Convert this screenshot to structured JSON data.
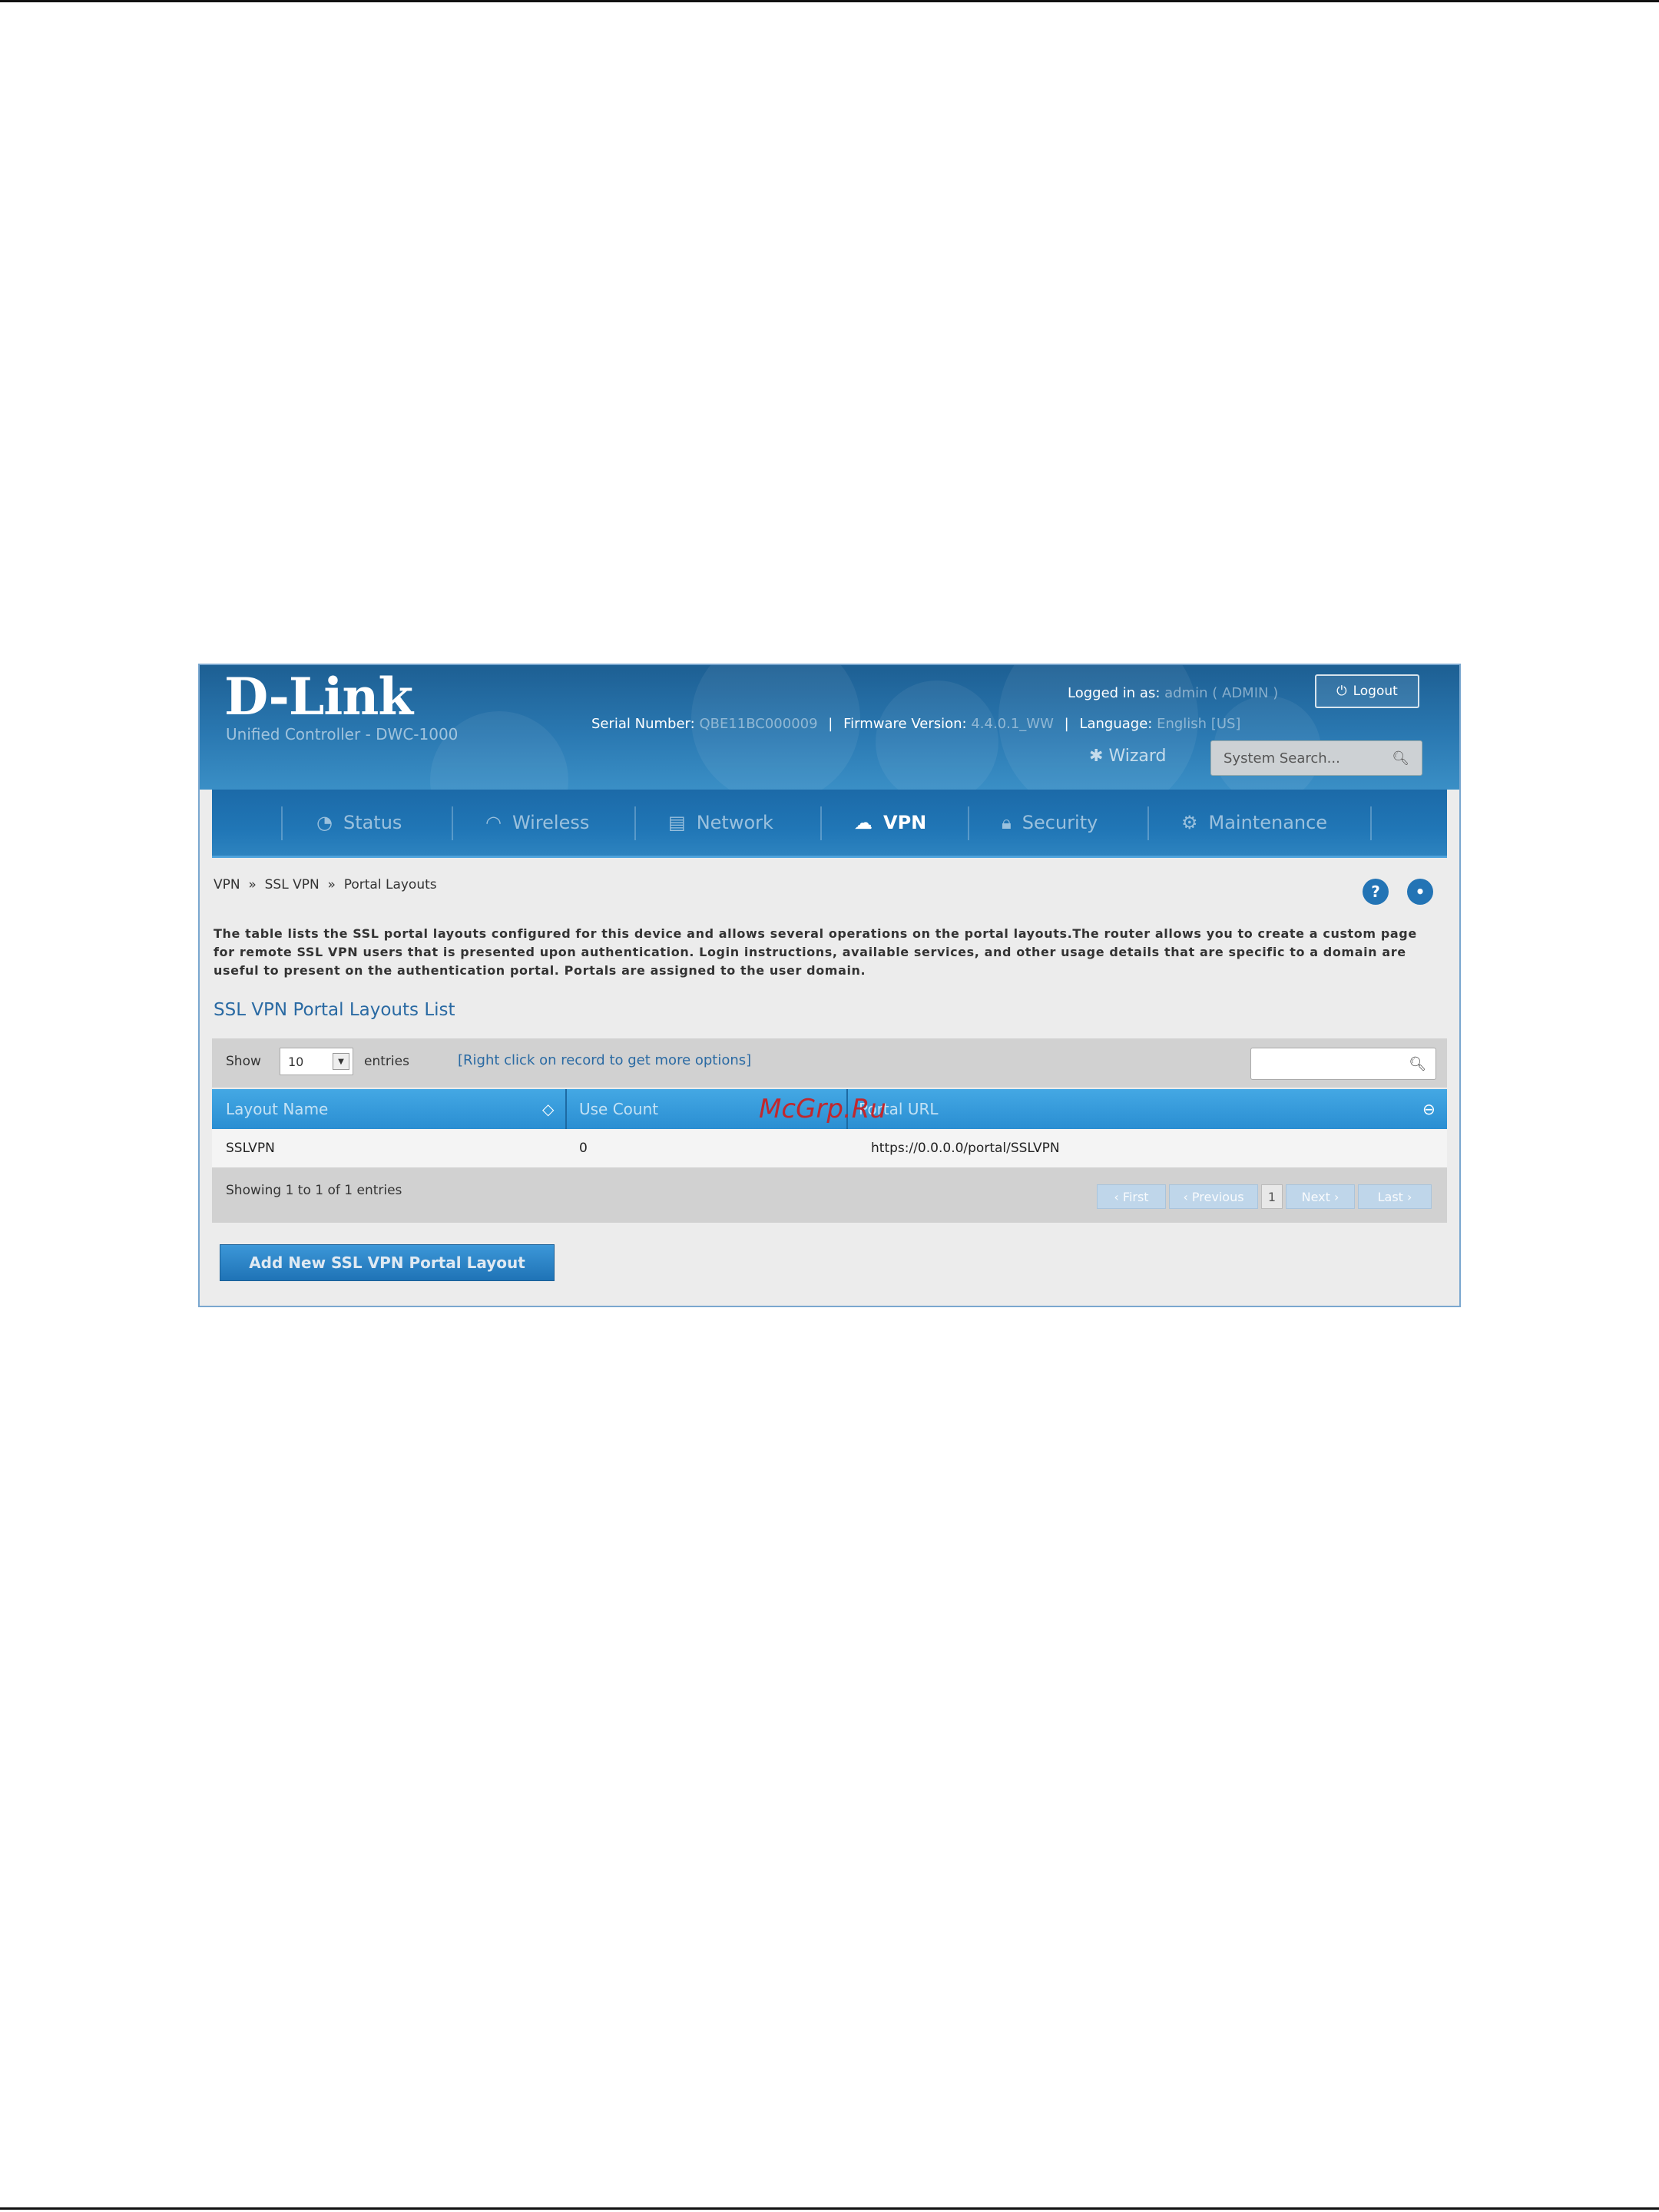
{
  "header": {
    "brand": "D-Link",
    "product": "Unified Controller - DWC-1000",
    "logged_in_label": "Logged in as:",
    "logged_in_user": "admin ( ADMIN )",
    "logout_label": "Logout",
    "serial_label": "Serial Number:",
    "serial_value": "QBE11BC000009",
    "firmware_label": "Firmware Version:",
    "firmware_value": "4.4.0.1_WW",
    "language_label": "Language:",
    "language_value": "English [US]",
    "wizard_label": "Wizard",
    "search_placeholder": "System Search..."
  },
  "nav": {
    "items": [
      {
        "label": "Status",
        "icon": "gauge-icon"
      },
      {
        "label": "Wireless",
        "icon": "wifi-icon"
      },
      {
        "label": "Network",
        "icon": "network-icon"
      },
      {
        "label": "VPN",
        "icon": "cloud-icon"
      },
      {
        "label": "Security",
        "icon": "lock-icon"
      },
      {
        "label": "Maintenance",
        "icon": "gears-icon"
      }
    ],
    "active": "VPN"
  },
  "breadcrumb": [
    "VPN",
    "SSL VPN",
    "Portal Layouts"
  ],
  "breadcrumb_sep": "»",
  "description": "The table lists the SSL portal layouts configured for this device and allows several operations on the portal layouts.The router allows you to create a custom page for remote SSL VPN users that is presented upon authentication. Login instructions, available services, and other usage details that are specific to a domain are useful to present on the authentication portal. Portals are assigned to the user domain.",
  "list_title": "SSL VPN Portal Layouts List",
  "toolbar": {
    "show_label": "Show",
    "page_size": "10",
    "entries_label": "entries",
    "hint": "[Right click on record to get more options]"
  },
  "table": {
    "columns": [
      "Layout Name",
      "Use Count",
      "Portal URL"
    ],
    "rows": [
      {
        "layout_name": "SSLVPN",
        "use_count": "0",
        "portal_url": "https://0.0.0.0/portal/SSLVPN"
      }
    ]
  },
  "footer": {
    "showing": "Showing 1 to 1 of 1 entries",
    "pagination": {
      "first": "First",
      "previous": "Previous",
      "current": "1",
      "next": "Next",
      "last": "Last"
    }
  },
  "add_button_label": "Add New SSL VPN Portal Layout",
  "watermark": "McGrp.Ru",
  "colors": {
    "header_blue": "#2a78b1",
    "accent_blue": "#2a8ed2",
    "link_blue": "#2a6aa3"
  }
}
